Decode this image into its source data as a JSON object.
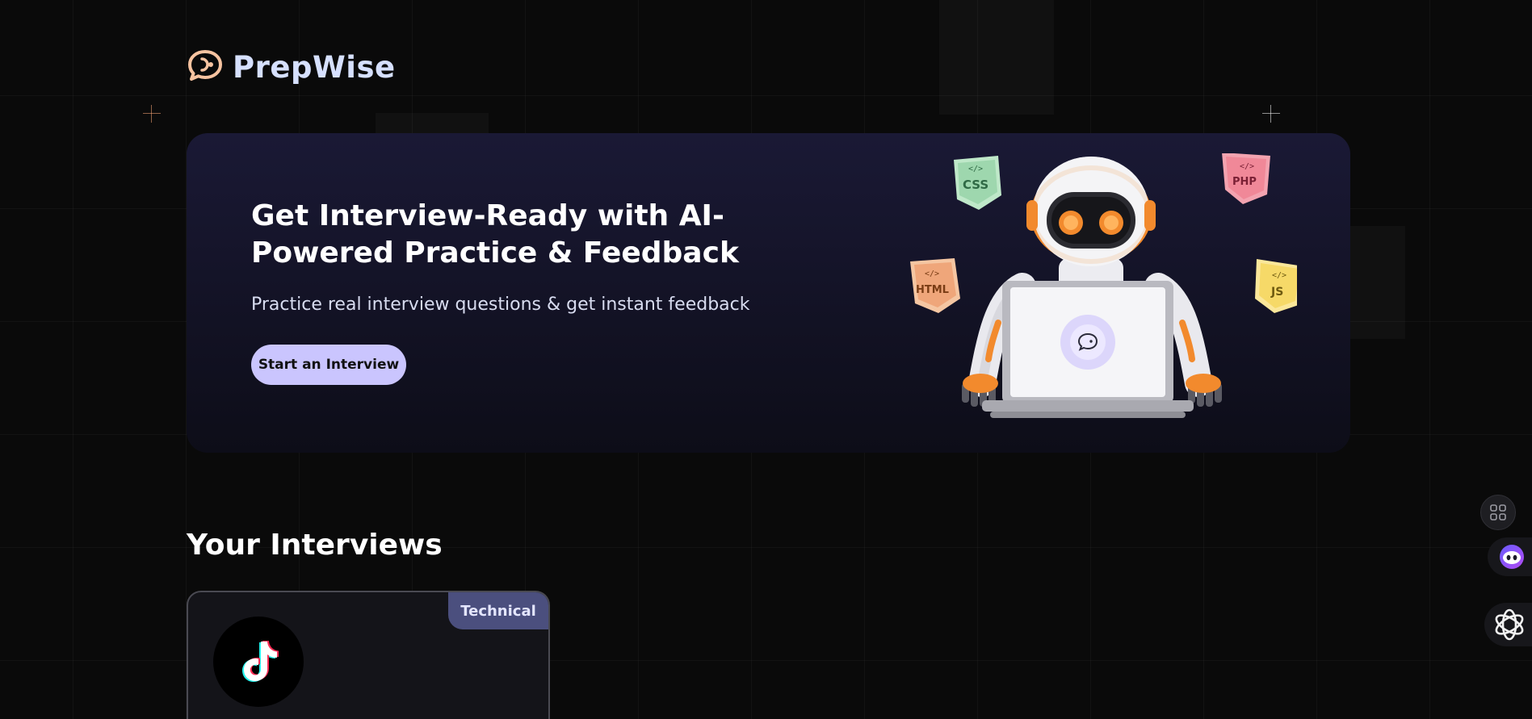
{
  "brand": {
    "name": "PrepWise",
    "logo_icon": "chat-bubble-icon",
    "accent_color": "#f7c3a0",
    "text_color": "#d6e0ff"
  },
  "hero": {
    "title": "Get Interview-Ready with AI-Powered Practice & Feedback",
    "subtitle": "Practice real interview questions & get instant feedback",
    "cta_label": "Start an Interview",
    "cta_color": "#cac5fe",
    "illustration": "robot-with-laptop",
    "tech_badges": [
      "CSS",
      "PHP",
      "HTML",
      "JS"
    ]
  },
  "interviews": {
    "heading": "Your Interviews",
    "cards": [
      {
        "type_badge": "Technical",
        "company_logo": "tiktok-logo-icon"
      }
    ]
  },
  "floating_toolbar": {
    "items": [
      "apps-grid-icon",
      "assistant-bot-icon",
      "openai-knot-icon"
    ]
  }
}
